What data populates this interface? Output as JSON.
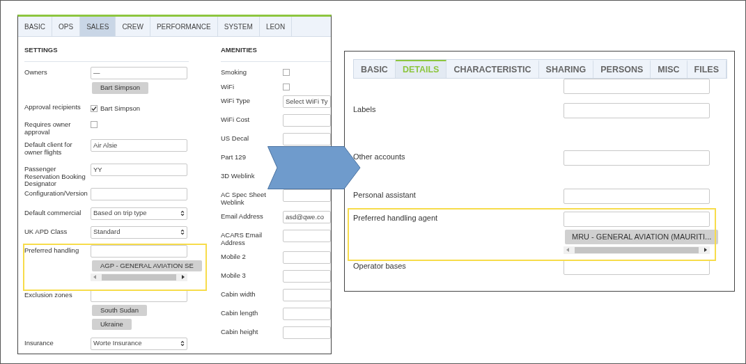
{
  "left_panel": {
    "tabs": [
      {
        "label": "BASIC",
        "selected": false
      },
      {
        "label": "OPS",
        "selected": false
      },
      {
        "label": "SALES",
        "selected": true
      },
      {
        "label": "CREW",
        "selected": false
      },
      {
        "label": "PERFORMANCE",
        "selected": false
      },
      {
        "label": "SYSTEM",
        "selected": false
      },
      {
        "label": "LEON",
        "selected": false
      }
    ],
    "settings": {
      "title": "SETTINGS",
      "fields": [
        {
          "kind": "input",
          "label": "Owners",
          "value": "—",
          "tags": [
            "Bart Simpson"
          ]
        },
        {
          "kind": "checkbox",
          "label": "Approval recipients",
          "checked": true,
          "option": "Bart Simpson"
        },
        {
          "kind": "checkbox",
          "label": "Requires owner approval",
          "checked": false
        },
        {
          "kind": "input",
          "label": "Default client for owner flights",
          "value": "Air Alsie"
        },
        {
          "kind": "input",
          "label": "Passenger Reservation Booking Designator",
          "value": "YY"
        },
        {
          "kind": "input",
          "label": "Configuration/Version"
        },
        {
          "kind": "select",
          "label": "Default commercial",
          "value": "Based on trip type"
        },
        {
          "kind": "select",
          "label": "UK APD Class",
          "value": "Standard"
        },
        {
          "kind": "input",
          "label": "Preferred handling",
          "highlighted": true,
          "tags": [
            "AGP - GENERAL AVIATION SE"
          ],
          "scrollbar": true
        },
        {
          "kind": "input",
          "label": "Exclusion zones",
          "tags": [
            "South Sudan",
            "Ukraine"
          ]
        },
        {
          "kind": "select",
          "label": "Insurance",
          "value": "Worte Insurance"
        }
      ]
    },
    "amenities": {
      "title": "AMENITIES",
      "fields": [
        {
          "kind": "checkbox",
          "label": "Smoking",
          "checked": false
        },
        {
          "kind": "checkbox",
          "label": "WiFi",
          "checked": false
        },
        {
          "kind": "input",
          "label": "WiFi Type",
          "value": "Select WiFi Ty"
        },
        {
          "kind": "input",
          "label": "WiFi Cost"
        },
        {
          "kind": "input",
          "label": "US Decal"
        },
        {
          "label": "Part 129"
        },
        {
          "label": "3D Weblink"
        },
        {
          "kind": "input",
          "label": "AC Spec Sheet Weblink"
        },
        {
          "kind": "input",
          "label": "Email Address",
          "value": "asd@qwe.co"
        },
        {
          "kind": "input",
          "label": "ACARS Email Address"
        },
        {
          "kind": "input",
          "label": "Mobile 2"
        },
        {
          "kind": "input",
          "label": "Mobile 3"
        },
        {
          "kind": "input",
          "label": "Cabin width"
        },
        {
          "kind": "input",
          "label": "Cabin length"
        },
        {
          "kind": "input",
          "label": "Cabin height"
        }
      ]
    }
  },
  "right_panel": {
    "tabs": [
      {
        "label": "BASIC",
        "selected": false
      },
      {
        "label": "DETAILS",
        "selected": true
      },
      {
        "label": "CHARACTERISTIC",
        "selected": false
      },
      {
        "label": "SHARING",
        "selected": false
      },
      {
        "label": "PERSONS",
        "selected": false
      },
      {
        "label": "MISC",
        "selected": false
      },
      {
        "label": "FILES",
        "selected": false
      }
    ],
    "fields": [
      {
        "kind": "input"
      },
      {
        "kind": "input",
        "label": "Labels"
      },
      {
        "kind": "input",
        "label": "Other accounts"
      },
      {
        "kind": "input",
        "label": "Personal assistant"
      },
      {
        "kind": "input",
        "label": "Preferred handling agent",
        "highlighted": true,
        "tags": [
          "MRU - GENERAL AVIATION (MAURITI..."
        ],
        "scrollbar": true
      },
      {
        "kind": "input",
        "label": "Operator bases"
      }
    ]
  }
}
